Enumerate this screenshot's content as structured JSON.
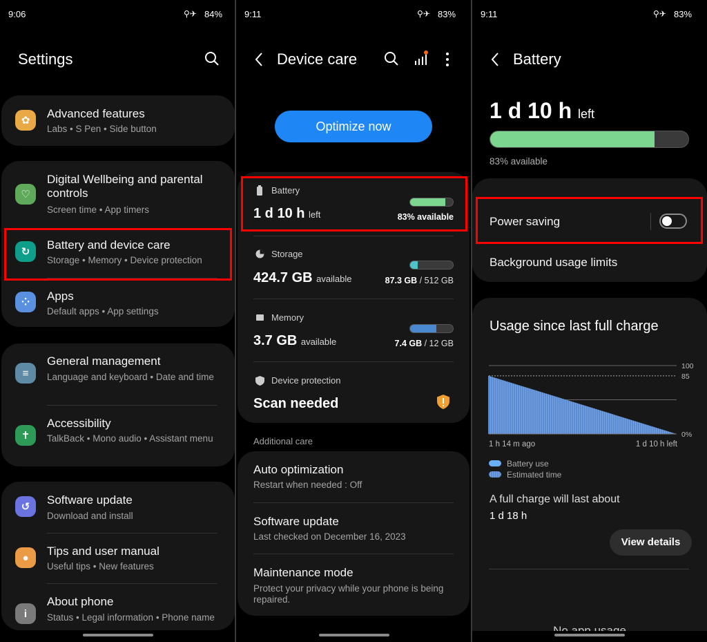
{
  "panel1": {
    "status": {
      "time": "9:06",
      "battery": "84%"
    },
    "title": "Settings",
    "items": [
      {
        "title": "Advanced features",
        "sub": "Labs  •  S Pen  •  Side button",
        "icon": "advanced-features-icon",
        "color": "#e9a944"
      },
      {
        "title": "Digital Wellbeing and parental controls",
        "sub": "Screen time  •  App timers",
        "icon": "digital-wellbeing-icon",
        "color": "#5faa5a"
      },
      {
        "title": "Battery and device care",
        "sub": "Storage  •  Memory  •  Device protection",
        "icon": "device-care-icon",
        "color": "#0f9e8a"
      },
      {
        "title": "Apps",
        "sub": "Default apps  •  App settings",
        "icon": "apps-icon",
        "color": "#5a90e0"
      },
      {
        "title": "General management",
        "sub": "Language and keyboard  •  Date and time",
        "icon": "sliders-icon",
        "color": "#5e8aa6"
      },
      {
        "title": "Accessibility",
        "sub": "TalkBack  •  Mono audio  •  Assistant menu",
        "icon": "accessibility-icon",
        "color": "#2e9a58"
      },
      {
        "title": "Software update",
        "sub": "Download and install",
        "icon": "software-update-icon",
        "color": "#6b73e0"
      },
      {
        "title": "Tips and user manual",
        "sub": "Useful tips  •  New features",
        "icon": "lightbulb-icon",
        "color": "#eb9a45"
      },
      {
        "title": "About phone",
        "sub": "Status  •  Legal information  •  Phone name",
        "icon": "info-icon",
        "color": "#7a7a7a"
      }
    ]
  },
  "panel2": {
    "status": {
      "time": "9:11",
      "battery": "83%"
    },
    "title": "Device care",
    "optimize": "Optimize now",
    "battery": {
      "label": "Battery",
      "value": "1 d 10 h",
      "unit": "left",
      "detail": "83% available",
      "percent": 83,
      "color": "#7dd68f"
    },
    "storage": {
      "label": "Storage",
      "value": "424.7 GB",
      "unit": "available",
      "used": "87.3 GB",
      "total": " / 512 GB",
      "percent": 17,
      "color": "#4fc3c7"
    },
    "memory": {
      "label": "Memory",
      "value": "3.7 GB",
      "unit": "available",
      "used": "7.4 GB",
      "total": " / 12 GB",
      "percent": 62,
      "color": "#4a88d0"
    },
    "protection": {
      "label": "Device protection",
      "value": "Scan needed",
      "color": "#f0a030"
    },
    "additional": "Additional care",
    "care": [
      {
        "title": "Auto optimization",
        "sub": "Restart when needed : Off"
      },
      {
        "title": "Software update",
        "sub": "Last checked on December 16, 2023"
      },
      {
        "title": "Maintenance mode",
        "sub": "Protect your privacy while your phone is being repaired."
      }
    ]
  },
  "panel3": {
    "status": {
      "time": "9:11",
      "battery": "83%"
    },
    "title": "Battery",
    "remaining": "1 d 10 h",
    "remaining_unit": "left",
    "available": "83% available",
    "percent": 83,
    "power_saving": "Power saving",
    "power_saving_on": false,
    "background": "Background usage limits",
    "usage_title": "Usage since last full charge",
    "legend": [
      "Battery use",
      "Estimated time"
    ],
    "full_charge": "A full charge will last about",
    "full_charge_value": "1 d 18 h",
    "view_details": "View details",
    "no_usage": "No app usage"
  },
  "chart_data": {
    "type": "area",
    "title": "Usage since last full charge",
    "x": [
      "1 h 14 m ago",
      "1 d 10 h left"
    ],
    "series": [
      {
        "name": "Estimated time",
        "values": [
          85,
          0
        ]
      }
    ],
    "ylim": [
      0,
      100
    ],
    "yticks": [
      "100",
      "85",
      "0%"
    ],
    "grid": true,
    "legend": "bottom-left"
  }
}
